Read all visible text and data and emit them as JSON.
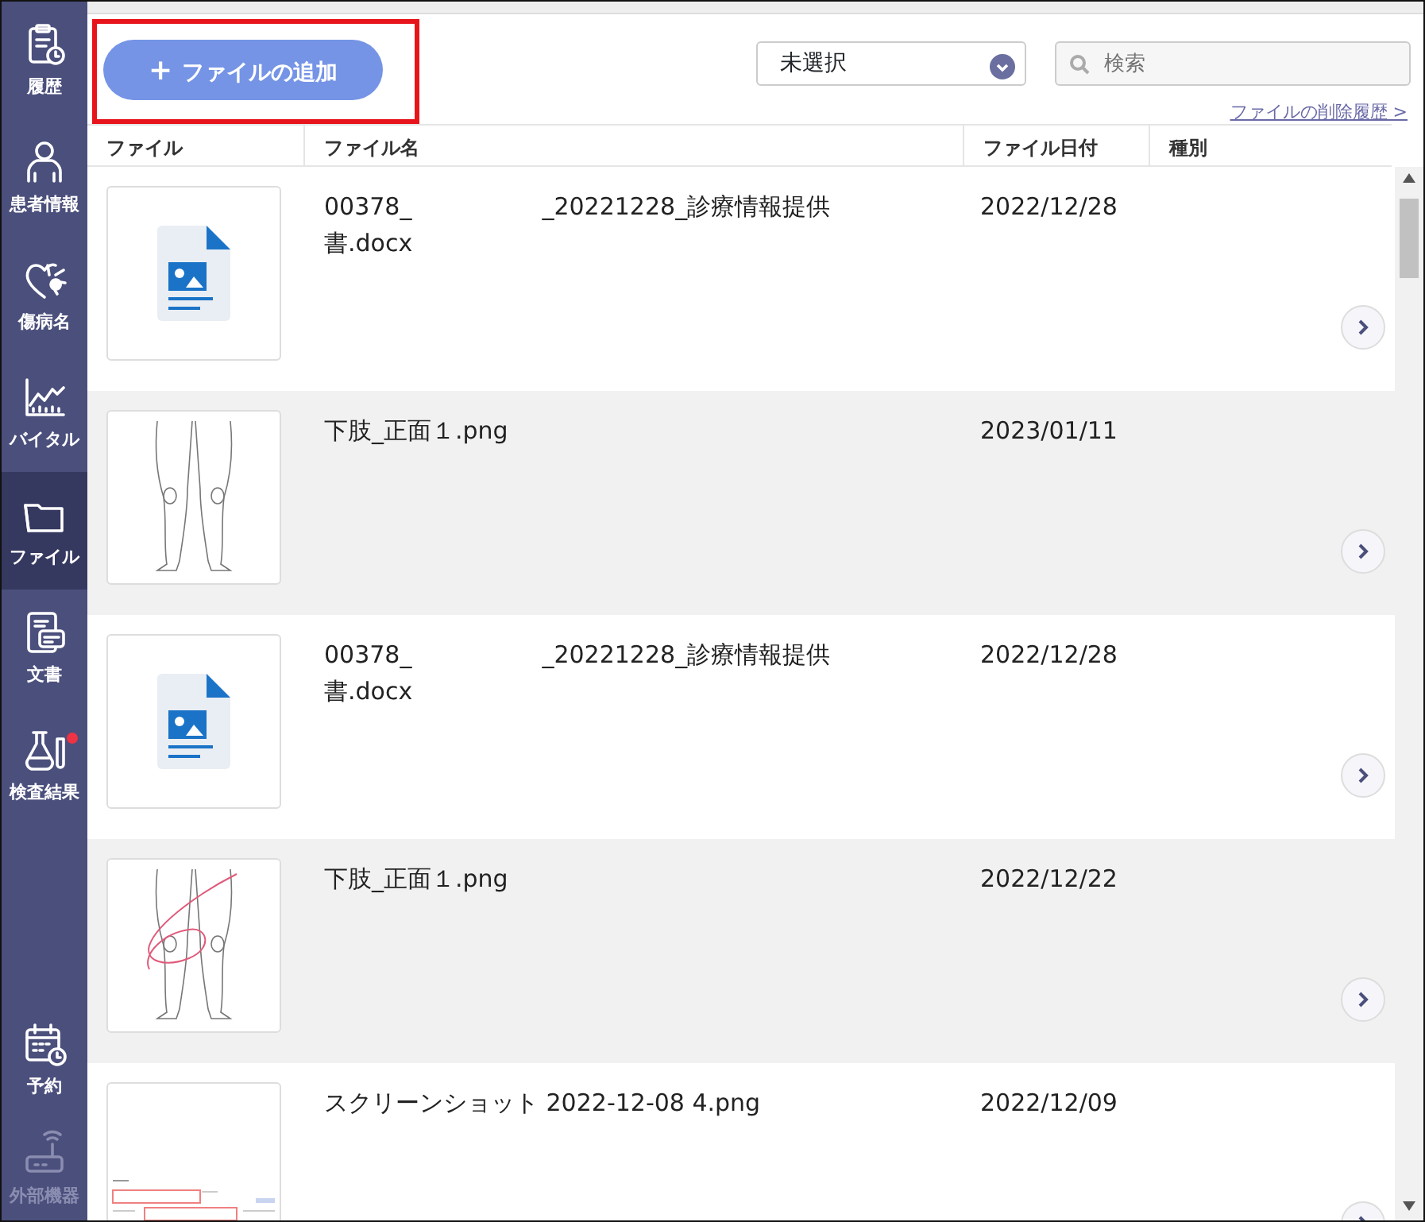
{
  "sidebar": {
    "items": [
      {
        "label": "履歴",
        "kind": "history",
        "selected": false,
        "disabled": false,
        "badge": false
      },
      {
        "label": "患者情報",
        "kind": "patient",
        "selected": false,
        "disabled": false,
        "badge": false
      },
      {
        "label": "傷病名",
        "kind": "disease",
        "selected": false,
        "disabled": false,
        "badge": false
      },
      {
        "label": "バイタル",
        "kind": "vital",
        "selected": false,
        "disabled": false,
        "badge": false
      },
      {
        "label": "ファイル",
        "kind": "folder",
        "selected": true,
        "disabled": false,
        "badge": false
      },
      {
        "label": "文書",
        "kind": "document",
        "selected": false,
        "disabled": false,
        "badge": false
      },
      {
        "label": "検査結果",
        "kind": "flask",
        "selected": false,
        "disabled": false,
        "badge": true
      }
    ],
    "bottom_items": [
      {
        "label": "予約",
        "kind": "calendar",
        "selected": false,
        "disabled": false,
        "badge": false
      },
      {
        "label": "外部機器",
        "kind": "device",
        "selected": false,
        "disabled": true,
        "badge": false
      }
    ]
  },
  "toolbar": {
    "add_button": "ファイルの追加",
    "add_icon": "+",
    "highlighted": true,
    "filter": {
      "value": "未選択"
    },
    "search": {
      "placeholder": "検索"
    },
    "deleted_history_link": "ファイルの削除履歴 >"
  },
  "table": {
    "columns": [
      "ファイル",
      "ファイル名",
      "ファイル日付",
      "種別"
    ],
    "rows": [
      {
        "kind": "document",
        "name_parts": [
          "00378_",
          "_20221228_診療情報提供書.docx"
        ],
        "date": "2022/12/28"
      },
      {
        "kind": "legs",
        "name_parts": [
          "下肢_正面１.png"
        ],
        "date": "2023/01/11"
      },
      {
        "kind": "document",
        "name_parts": [
          "00378_",
          "_20221228_診療情報提供書.docx"
        ],
        "date": "2022/12/28"
      },
      {
        "kind": "legs-annotated",
        "name_parts": [
          "下肢_正面１.png"
        ],
        "date": "2022/12/22"
      },
      {
        "kind": "screenshot",
        "name_parts": [
          "スクリーンショット 2022-12-08 4.png"
        ],
        "date": "2022/12/09"
      }
    ]
  }
}
